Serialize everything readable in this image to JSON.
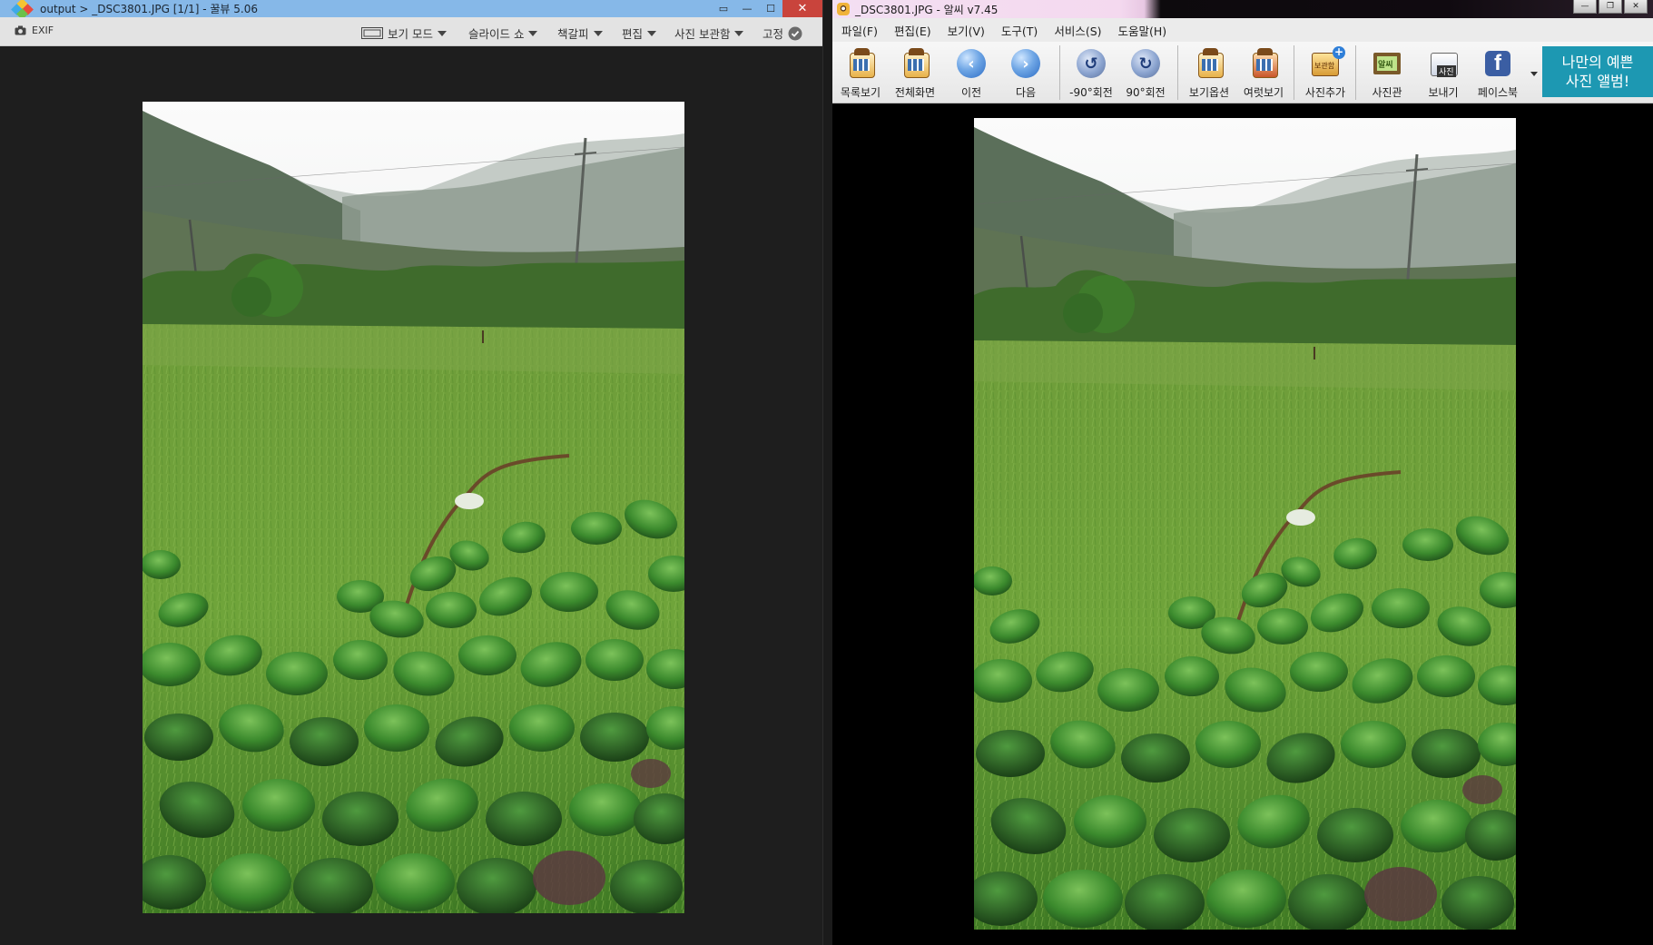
{
  "left_window": {
    "title": "output > _DSC3801.JPG [1/1] - 꿀뷰 5.06",
    "window_buttons": {
      "restore": "▭",
      "minimize": "—",
      "maximize": "☐",
      "close": "✕"
    },
    "toolbar": {
      "exif": "EXIF",
      "view_mode": "보기 모드",
      "slideshow": "슬라이드 쇼",
      "bookmark": "책갈피",
      "edit": "편집",
      "photo_storage": "사진 보관함",
      "pin": "고정"
    },
    "colors": {
      "title_bar": "#86b8e8",
      "close": "#c9443c",
      "background": "#1e1e1e"
    }
  },
  "right_window": {
    "title": "_DSC3801.JPG - 알씨 v7.45",
    "window_buttons": {
      "minimize": "—",
      "restore": "❐",
      "close": "✕"
    },
    "menu": [
      "파일(F)",
      "편집(E)",
      "보기(V)",
      "도구(T)",
      "서비스(S)",
      "도움말(H)"
    ],
    "toolbar": {
      "list_view": "목록보기",
      "fullscreen": "전체화면",
      "prev": "이전",
      "next": "다음",
      "rotate_left": "-90°회전",
      "rotate_right": "90°회전",
      "view_options": "보기옵션",
      "multi_view": "여럿보기",
      "add_photo": "사진추가",
      "add_photo_badge": "보관함",
      "photo_board": "사진관",
      "photo_board_badge": "알씨",
      "send": "보내기",
      "send_badge": "사진",
      "facebook": "페이스북"
    },
    "banner": {
      "line1": "나만의 예쁜",
      "line2": "사진 앨범!"
    },
    "colors": {
      "banner": "#1d98b2",
      "facebook": "#3b5ea3",
      "background": "#000000"
    }
  },
  "photo": {
    "subject": "rice-paddy-field-with-sweet-potato-leaves"
  }
}
